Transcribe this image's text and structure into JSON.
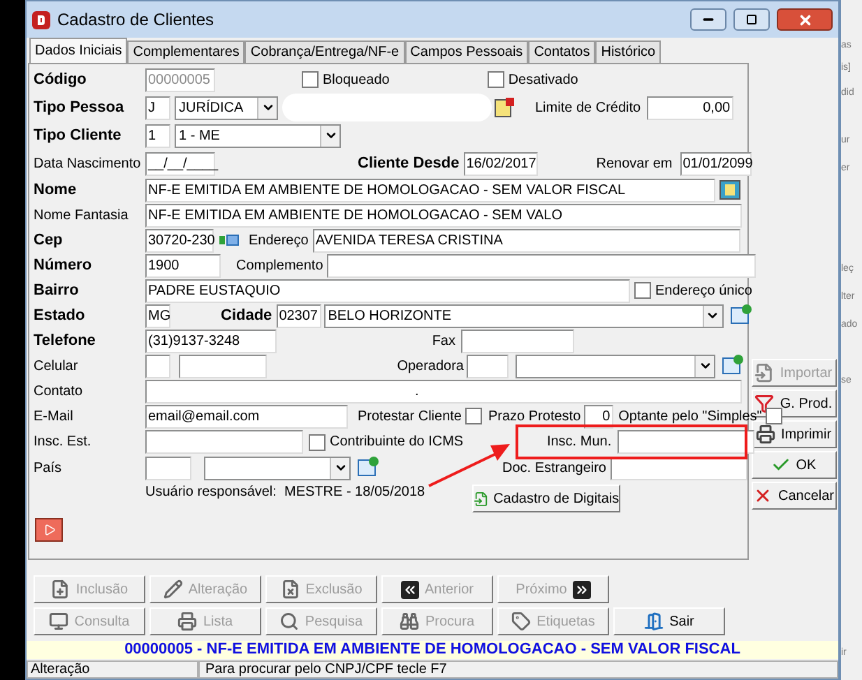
{
  "window": {
    "title": "Cadastro de Clientes"
  },
  "tabs": [
    {
      "label": "Dados Iniciais",
      "selected": true
    },
    {
      "label": "Complementares",
      "selected": false
    },
    {
      "label": "Cobrança/Entrega/NF-e",
      "selected": false
    },
    {
      "label": "Campos Pessoais",
      "selected": false
    },
    {
      "label": "Contatos",
      "selected": false
    },
    {
      "label": "Histórico",
      "selected": false
    }
  ],
  "fields": {
    "codigo": {
      "label": "Código",
      "required": true,
      "value": "00000005",
      "disabled": true
    },
    "bloqueado": {
      "label": "Bloqueado",
      "checked": false
    },
    "desativado": {
      "label": "Desativado",
      "checked": false
    },
    "tipo_pessoa": {
      "label": "Tipo Pessoa",
      "required": true,
      "code": "J",
      "value": "JURÍDICA"
    },
    "limite_credito": {
      "label": "Limite de Crédito",
      "value": "0,00"
    },
    "tipo_cliente": {
      "label": "Tipo Cliente",
      "required": true,
      "code": "1",
      "value": "1 - ME"
    },
    "data_nascimento": {
      "label": "Data Nascimento",
      "required": false,
      "value": "__/__/____"
    },
    "cliente_desde": {
      "label": "Cliente Desde",
      "required": true,
      "value": "16/02/2017"
    },
    "renovar_em": {
      "label": "Renovar em",
      "value": "01/01/2099"
    },
    "nome": {
      "label": "Nome",
      "required": true,
      "value": "NF-E EMITIDA EM AMBIENTE DE HOMOLOGACAO - SEM VALOR FISCAL"
    },
    "nome_fantasia": {
      "label": "Nome Fantasia",
      "required": false,
      "value": "NF-E EMITIDA EM AMBIENTE DE HOMOLOGACAO - SEM VALO"
    },
    "cep": {
      "label": "Cep",
      "required": true,
      "value": "30720-230"
    },
    "endereco": {
      "label": "Endereço",
      "value": "AVENIDA TERESA CRISTINA"
    },
    "numero": {
      "label": "Número",
      "required": true,
      "value": "1900"
    },
    "complemento": {
      "label": "Complemento"
    },
    "bairro": {
      "label": "Bairro",
      "required": true,
      "value": "PADRE EUSTAQUIO"
    },
    "endereco_unico": {
      "label": "Endereço único",
      "checked": false
    },
    "estado": {
      "label": "Estado",
      "required": true,
      "value": "MG"
    },
    "cidade": {
      "label": "Cidade",
      "required": true,
      "code": "02307",
      "value": "BELO HORIZONTE"
    },
    "telefone": {
      "label": "Telefone",
      "required": true,
      "value": "(31)9137-3248"
    },
    "fax": {
      "label": "Fax"
    },
    "celular": {
      "label": "Celular",
      "required": false
    },
    "operadora": {
      "label": "Operadora"
    },
    "contato": {
      "label": "Contato",
      "required": false,
      "value": "."
    },
    "email": {
      "label": "E-Mail",
      "required": false,
      "value": "email@email.com"
    },
    "protestar": {
      "label": "Protestar Cliente",
      "checked": false
    },
    "prazo_protesto": {
      "label": "Prazo Protesto",
      "value": "0"
    },
    "optante_simples": {
      "label": "Optante pelo \"Simples\"",
      "checked": false
    },
    "insc_est": {
      "label": "Insc. Est.",
      "required": false
    },
    "contribuinte_icms": {
      "label": "Contribuinte do ICMS",
      "checked": false
    },
    "insc_mun": {
      "label": "Insc. Mun.",
      "highlighted": true
    },
    "pais": {
      "label": "País",
      "required": false
    },
    "doc_estrangeiro": {
      "label": "Doc. Estrangeiro"
    }
  },
  "responsible_user": "Usuário responsável:  MESTRE - 18/05/2018",
  "digitais_button": "Cadastro de Digitais",
  "side_buttons": [
    {
      "label": "Importar",
      "disabled": true
    },
    {
      "label": "G. Prod.",
      "disabled": false
    },
    {
      "label": "Imprimir",
      "disabled": false
    },
    {
      "label": "OK",
      "disabled": false
    },
    {
      "label": "Cancelar",
      "disabled": false
    }
  ],
  "nav_buttons": [
    [
      {
        "label": "Inclusão",
        "disabled": true
      },
      {
        "label": "Alteração",
        "disabled": true
      },
      {
        "label": "Exclusão",
        "disabled": true
      },
      {
        "label": "Anterior",
        "disabled": true
      },
      {
        "label": "Próximo",
        "disabled": true
      }
    ],
    [
      {
        "label": "Consulta",
        "disabled": true
      },
      {
        "label": "Lista",
        "disabled": true
      },
      {
        "label": "Pesquisa",
        "disabled": true
      },
      {
        "label": "Procura",
        "disabled": true
      },
      {
        "label": "Etiquetas",
        "disabled": true
      },
      {
        "label": "Sair",
        "disabled": false
      }
    ]
  ],
  "header_bar": "00000005 - NF-E EMITIDA EM AMBIENTE DE HOMOLOGACAO - SEM VALOR FISCAL",
  "status_bar": [
    "Alteração",
    "Para procurar pelo CNPJ/CPF tecle F7"
  ],
  "background_window": [
    "as",
    "is]",
    "did",
    "ur",
    "er",
    "leç",
    "lter",
    "ado",
    "se",
    "ir"
  ]
}
